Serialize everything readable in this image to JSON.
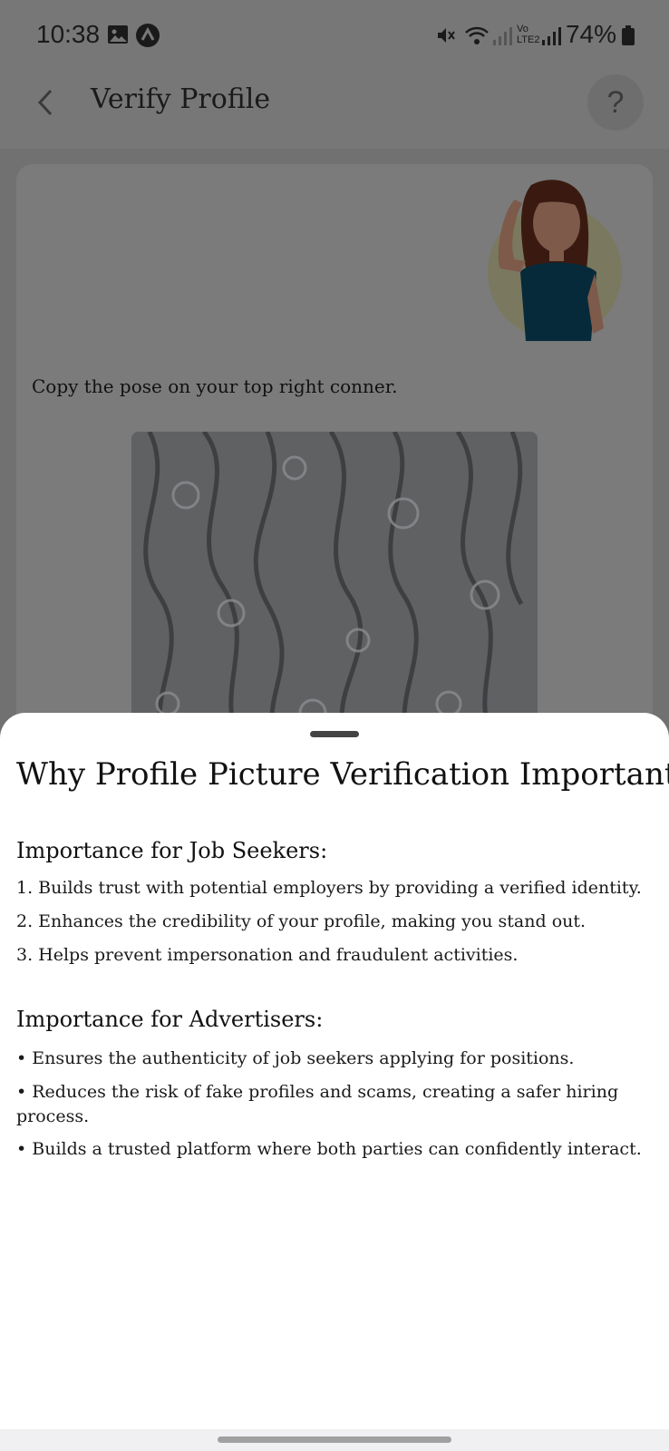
{
  "status_bar": {
    "time": "10:38",
    "battery": "74%",
    "icons": [
      "gallery-icon",
      "app-notification-icon",
      "mute-icon",
      "wifi-icon",
      "signal-icon",
      "volte-icon",
      "signal-icon",
      "battery-icon"
    ],
    "volte_label": "Vo LTE2"
  },
  "header": {
    "title": "Verify Profile",
    "help_label": "?"
  },
  "verify": {
    "instruction": "Copy the pose on your top right conner."
  },
  "sheet": {
    "title": "Why Profile Picture Verification Important?",
    "job_seekers": {
      "heading": "Importance for Job Seekers:",
      "items": [
        "1. Builds trust with potential employers by providing a verified identity.",
        "2. Enhances the credibility of your profile, making you stand out.",
        "3. Helps prevent impersonation and fraudulent activities."
      ]
    },
    "advertisers": {
      "heading": "Importance for Advertisers:",
      "items": [
        "• Ensures the authenticity of job seekers applying for positions.",
        "• Reduces the risk of fake profiles and scams, creating a safer hiring process.",
        "• Builds a trusted platform where both parties can confidently interact."
      ]
    }
  },
  "colors": {
    "scrim": "#7b7b7b",
    "sheet_bg": "#ffffff",
    "text": "#111111"
  }
}
